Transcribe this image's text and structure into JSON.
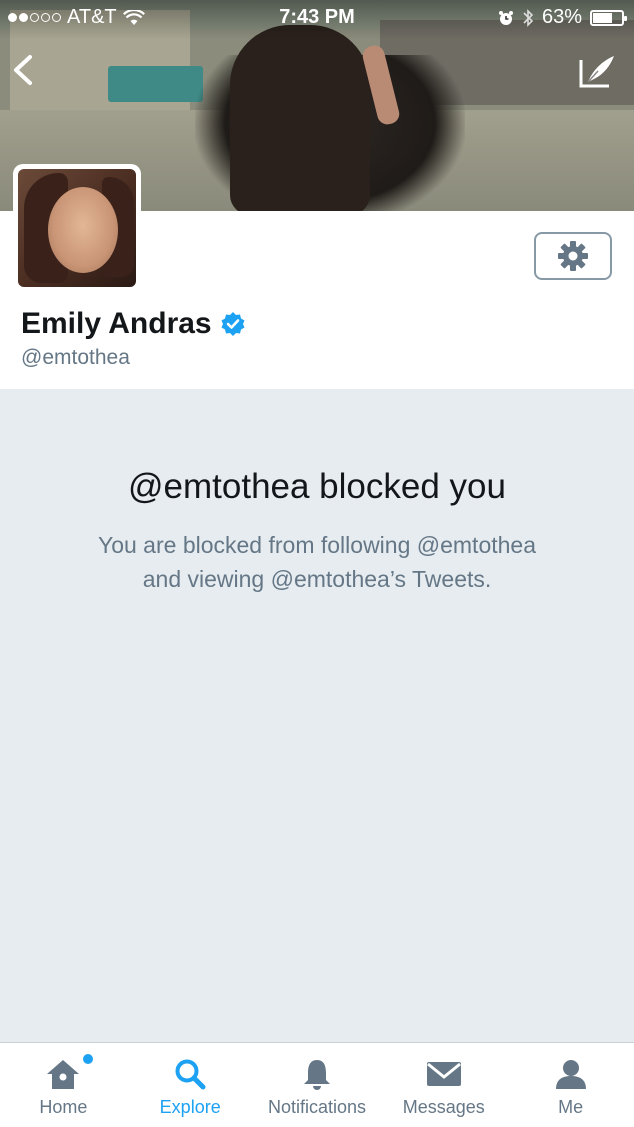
{
  "status_bar": {
    "carrier": "AT&T",
    "time": "7:43 PM",
    "battery": "63%",
    "battery_level": 0.63
  },
  "header": {
    "back_icon": "chevron-left-icon",
    "compose_icon": "compose-tweet-icon"
  },
  "profile": {
    "name": "Emily Andras",
    "handle": "@emtothea",
    "verified": true,
    "settings_icon": "gear-icon"
  },
  "blocked": {
    "title": "@emtothea blocked you",
    "body_line1": "You are blocked from following @emtothea",
    "body_line2": "and viewing @emtothea’s Tweets."
  },
  "tabs": [
    {
      "label": "Home",
      "icon": "home-icon",
      "active": false,
      "badge": true
    },
    {
      "label": "Explore",
      "icon": "search-icon",
      "active": true
    },
    {
      "label": "Notifications",
      "icon": "bell-icon",
      "active": false
    },
    {
      "label": "Messages",
      "icon": "envelope-icon",
      "active": false
    },
    {
      "label": "Me",
      "icon": "person-icon",
      "active": false
    }
  ],
  "colors": {
    "accent": "#1da1f2",
    "text_primary": "#14171a",
    "text_secondary": "#657786",
    "background": "#e6ecf0"
  }
}
